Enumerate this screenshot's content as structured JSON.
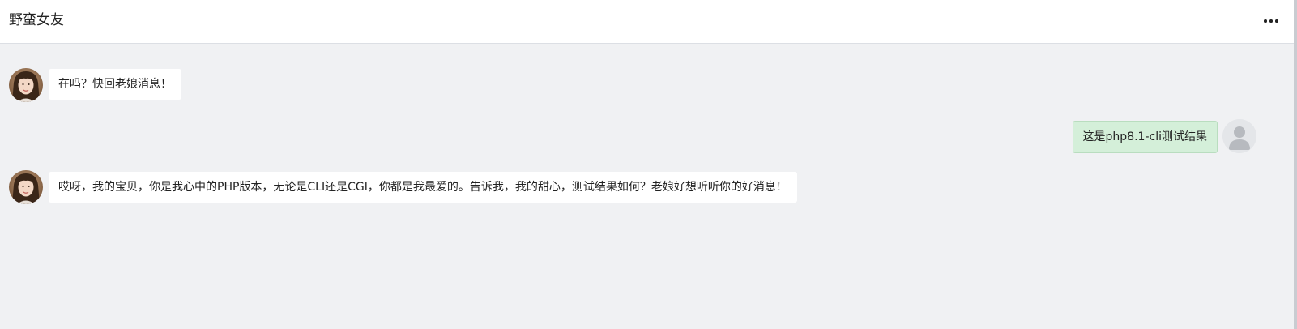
{
  "header": {
    "title": "野蛮女友",
    "more_icon": "more-horizontal-icon"
  },
  "messages": [
    {
      "role": "bot",
      "avatar": "girlfriend-avatar",
      "text": "在吗？快回老娘消息！"
    },
    {
      "role": "user",
      "avatar": "default-user-avatar",
      "text": "这是php8.1-cli测试结果"
    },
    {
      "role": "bot",
      "avatar": "girlfriend-avatar",
      "text": "哎呀，我的宝贝，你是我心中的PHP版本，无论是CLI还是CGI，你都是我最爱的。告诉我，我的甜心，测试结果如何？老娘好想听听你的好消息！"
    }
  ],
  "colors": {
    "background": "#f0f1f3",
    "header": "#ffffff",
    "bot_bubble": "#ffffff",
    "user_bubble": "#d4efd9"
  }
}
